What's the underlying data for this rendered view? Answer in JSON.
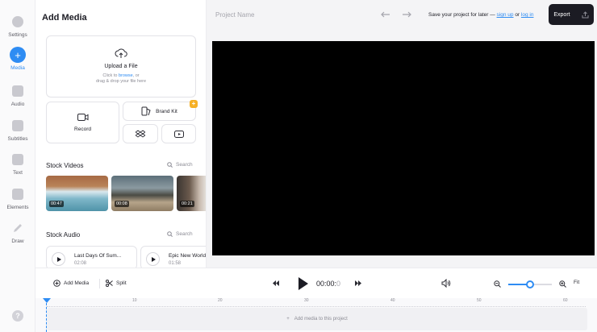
{
  "sidebar": {
    "items": [
      {
        "label": "Settings",
        "icon": "gear-icon"
      },
      {
        "label": "Media",
        "icon": "plus-icon",
        "active": true
      },
      {
        "label": "Audio",
        "icon": "music-note-icon"
      },
      {
        "label": "Subtitles",
        "icon": "subtitles-icon"
      },
      {
        "label": "Text",
        "icon": "text-icon"
      },
      {
        "label": "Elements",
        "icon": "shapes-icon"
      },
      {
        "label": "Draw",
        "icon": "pencil-icon"
      }
    ],
    "help_glyph": "?"
  },
  "panel": {
    "title": "Add Media",
    "upload": {
      "title": "Upload a File",
      "line1_prefix": "Click to ",
      "line1_link": "browse",
      "line1_suffix": ", or",
      "line2": "drag & drop your file here"
    },
    "record_label": "Record",
    "brand_kit_label": "Brand Kit",
    "stock_videos": {
      "title": "Stock Videos",
      "search": "Search",
      "items": [
        {
          "duration": "00:47"
        },
        {
          "duration": "00:08"
        },
        {
          "duration": "00:21"
        }
      ]
    },
    "stock_audio": {
      "title": "Stock Audio",
      "search": "Search",
      "items": [
        {
          "name": "Last Days Of Sum...",
          "duration": "02:08"
        },
        {
          "name": "Epic New World",
          "duration": "01:58"
        }
      ]
    }
  },
  "header": {
    "project_placeholder": "Project Name",
    "save_prefix": "Save your project for later — ",
    "sign_up": "sign up",
    "or": " or ",
    "log_in": "log in",
    "export_label": "Export"
  },
  "player": {
    "add_media": "Add Media",
    "split": "Split",
    "time_main": "00:00:",
    "time_dim": "0",
    "fit": "Fit",
    "zoom_level": 0.5
  },
  "timeline": {
    "ticks": [
      "10",
      "20",
      "30",
      "40",
      "50",
      "60"
    ],
    "add_media_hint": "Add media to this project"
  },
  "colors": {
    "accent": "#2e8cf3",
    "export_bg": "#1b1b23",
    "badge": "#f6b026"
  }
}
